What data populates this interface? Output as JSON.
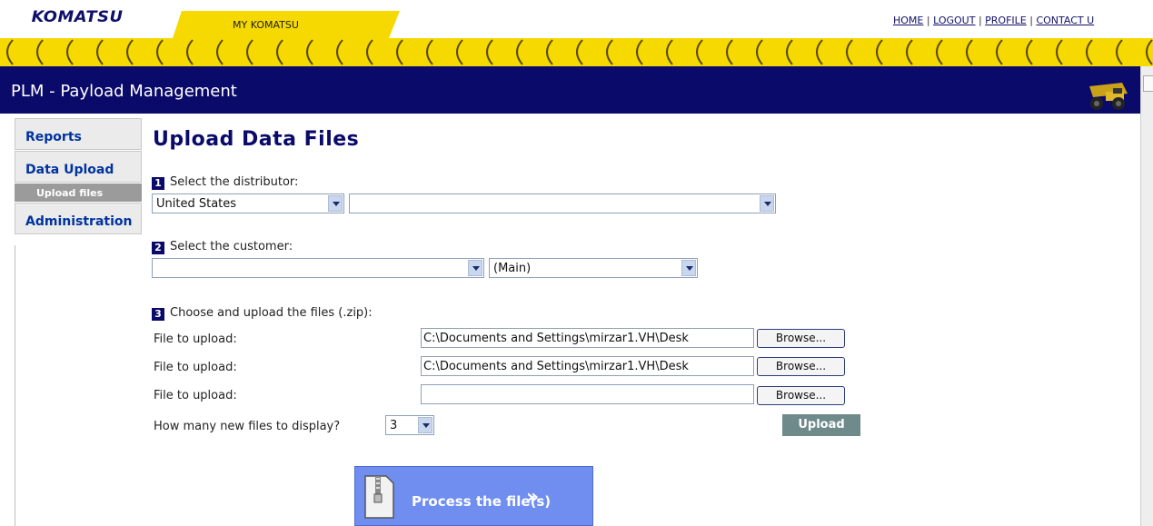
{
  "header": {
    "logo": "KOMATSU",
    "my_tab": "MY KOMATSU",
    "links": [
      "HOME",
      "LOGOUT",
      "PROFILE",
      "CONTACT U"
    ],
    "app_title": "PLM - Payload Management"
  },
  "nav": {
    "items": [
      "Reports",
      "Data Upload",
      "Administration"
    ],
    "sub_item": "Upload files"
  },
  "main": {
    "title": "Upload Data Files",
    "step1": {
      "num": "1",
      "label": "Select the distributor:",
      "country": "United States",
      "distributor": ""
    },
    "step2": {
      "num": "2",
      "label": "Select the customer:",
      "customer": "",
      "location": "(Main)"
    },
    "step3": {
      "num": "3",
      "label": "Choose and upload the files (.zip):"
    },
    "files": [
      {
        "label": "File to upload:",
        "value": "C:\\Documents and Settings\\mirzar1.VH\\Desk",
        "button": "Browse..."
      },
      {
        "label": "File to upload:",
        "value": "C:\\Documents and Settings\\mirzar1.VH\\Desk",
        "button": "Browse..."
      },
      {
        "label": "File to upload:",
        "value": "",
        "button": "Browse..."
      }
    ],
    "display_count_label": "How many new files to display?",
    "display_count": "3",
    "upload_button": "Upload",
    "process_button": "Process the file(s)",
    "process_chevron": "»"
  },
  "colors": {
    "navy": "#0a0a6a",
    "yellow": "#f5d900",
    "link_blue": "#0033a0",
    "process_blue": "#6f8ef0",
    "upload_gray": "#6f8a8a"
  }
}
